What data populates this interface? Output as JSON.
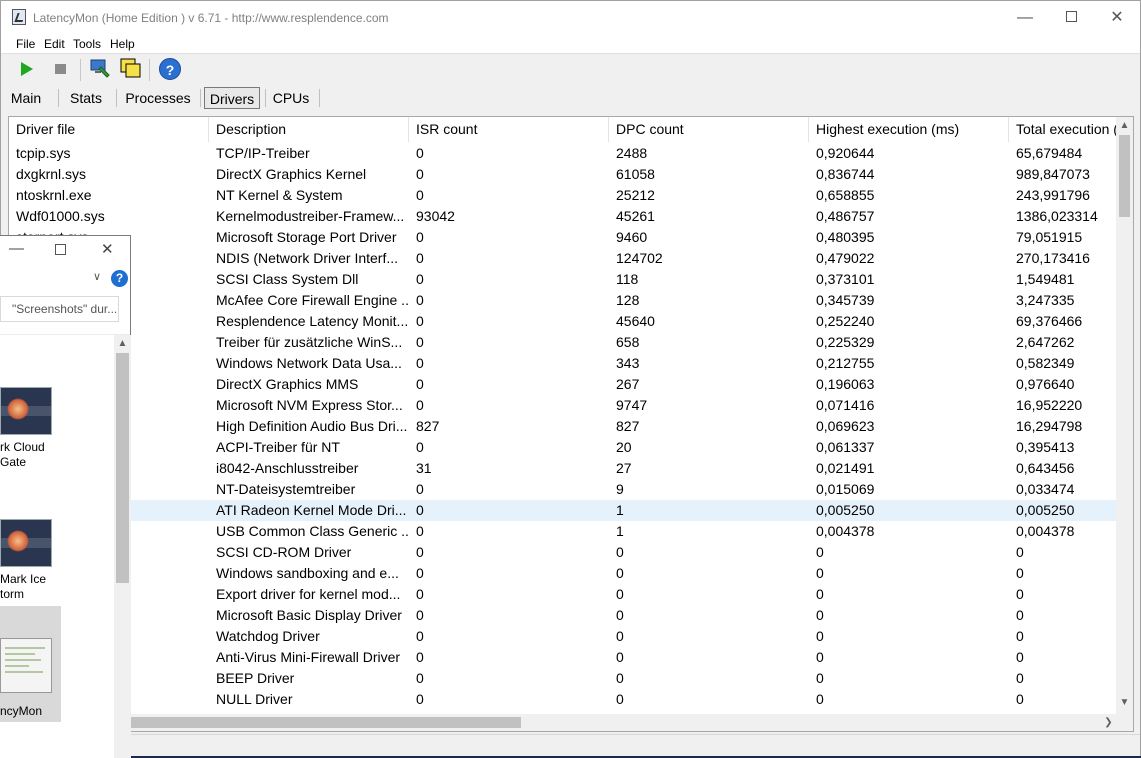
{
  "window": {
    "title": "LatencyMon  (Home Edition )  v 6.71 - http://www.resplendence.com"
  },
  "menu": [
    "File",
    "Edit",
    "Tools",
    "Help"
  ],
  "tabs": [
    "Main",
    "Stats",
    "Processes",
    "Drivers",
    "CPUs"
  ],
  "selected_tab": "Drivers",
  "table": {
    "columns": [
      "Driver file",
      "Description",
      "ISR count",
      "DPC count",
      "Highest execution (ms)",
      "Total execution ("
    ],
    "rows": [
      [
        "tcpip.sys",
        "TCP/IP-Treiber",
        "0",
        "2488",
        "0,920644",
        "65,679484"
      ],
      [
        "dxgkrnl.sys",
        "DirectX Graphics Kernel",
        "0",
        "61058",
        "0,836744",
        "989,847073"
      ],
      [
        "ntoskrnl.exe",
        "NT Kernel & System",
        "0",
        "25212",
        "0,658855",
        "243,991796"
      ],
      [
        "Wdf01000.sys",
        "Kernelmodustreiber-Framew...",
        "93042",
        "45261",
        "0,486757",
        "1386,023314"
      ],
      [
        "storport.sys",
        "Microsoft Storage Port Driver",
        "0",
        "9460",
        "0,480395",
        "79,051915"
      ],
      [
        "",
        "NDIS (Network Driver Interf...",
        "0",
        "124702",
        "0,479022",
        "270,173416"
      ],
      [
        "",
        "SCSI Class System Dll",
        "0",
        "118",
        "0,373101",
        "1,549481"
      ],
      [
        "",
        "McAfee Core Firewall Engine ...",
        "0",
        "128",
        "0,345739",
        "3,247335"
      ],
      [
        "",
        "Resplendence Latency Monit...",
        "0",
        "45640",
        "0,252240",
        "69,376466"
      ],
      [
        "",
        "Treiber für zusätzliche WinS...",
        "0",
        "658",
        "0,225329",
        "2,647262"
      ],
      [
        "",
        "Windows Network Data Usa...",
        "0",
        "343",
        "0,212755",
        "0,582349"
      ],
      [
        "",
        "DirectX Graphics MMS",
        "0",
        "267",
        "0,196063",
        "0,976640"
      ],
      [
        "",
        "Microsoft NVM Express Stor...",
        "0",
        "9747",
        "0,071416",
        "16,952220"
      ],
      [
        "",
        "High Definition Audio Bus Dri...",
        "827",
        "827",
        "0,069623",
        "16,294798"
      ],
      [
        "",
        "ACPI-Treiber für NT",
        "0",
        "20",
        "0,061337",
        "0,395413"
      ],
      [
        "",
        "i8042-Anschlusstreiber",
        "31",
        "27",
        "0,021491",
        "0,643456"
      ],
      [
        "",
        "NT-Dateisystemtreiber",
        "0",
        "9",
        "0,015069",
        "0,033474"
      ],
      [
        "",
        "ATI Radeon Kernel Mode Dri...",
        "0",
        "1",
        "0,005250",
        "0,005250"
      ],
      [
        "",
        "USB Common Class Generic ...",
        "0",
        "1",
        "0,004378",
        "0,004378"
      ],
      [
        "",
        "SCSI CD-ROM Driver",
        "0",
        "0",
        "0",
        "0"
      ],
      [
        "",
        "Windows sandboxing and e...",
        "0",
        "0",
        "0",
        "0"
      ],
      [
        "",
        "Export driver for kernel mod...",
        "0",
        "0",
        "0",
        "0"
      ],
      [
        "",
        "Microsoft Basic Display Driver",
        "0",
        "0",
        "0",
        "0"
      ],
      [
        "",
        "Watchdog Driver",
        "0",
        "0",
        "0",
        "0"
      ],
      [
        "",
        "Anti-Virus Mini-Firewall Driver",
        "0",
        "0",
        "0",
        "0"
      ],
      [
        "",
        "BEEP Driver",
        "0",
        "0",
        "0",
        "0"
      ],
      [
        "",
        "NULL Driver",
        "0",
        "0",
        "0",
        "0"
      ]
    ],
    "selected_row": 17
  },
  "explorer": {
    "search_placeholder": "\"Screenshots\" dur...",
    "items": [
      {
        "label_line1": "rk Cloud",
        "label_line2": "Gate"
      },
      {
        "label_line1": "Mark Ice",
        "label_line2": "torm"
      },
      {
        "label_line1": "ncyMon",
        "label_line2": ""
      }
    ]
  },
  "colors": {
    "selection": "#e5f1fb",
    "play": "#1ea81e",
    "help": "#2b6fd0"
  }
}
